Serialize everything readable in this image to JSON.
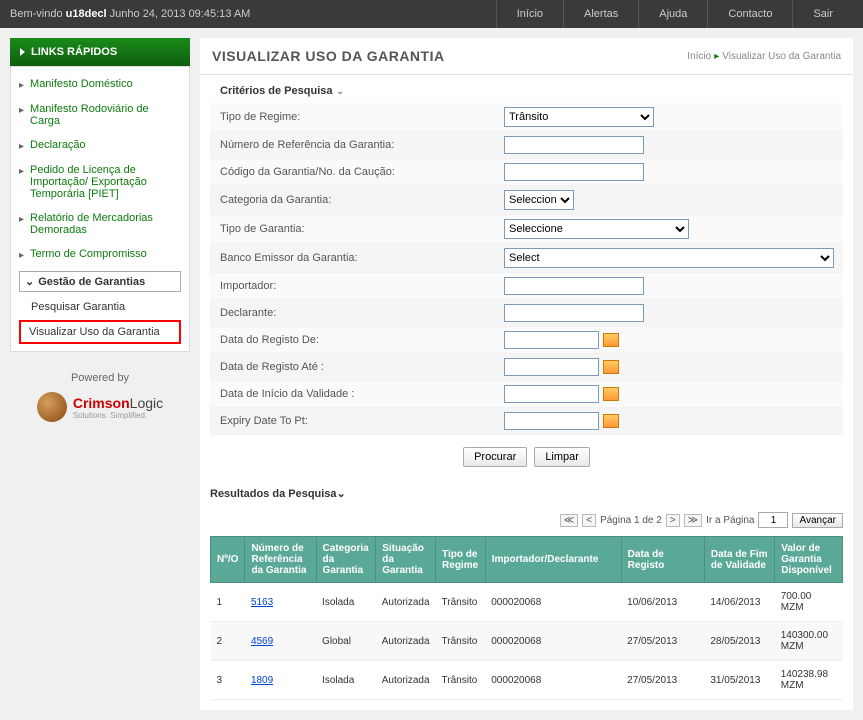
{
  "topbar": {
    "welcome_prefix": "Bem-vindo ",
    "user": "u18decl",
    "datetime": " Junho 24, 2013 09:45:13 AM",
    "nav": [
      "Início",
      "Alertas",
      "Ajuda",
      "Contacto",
      "Sair"
    ]
  },
  "sidebar": {
    "header": "LINKS RÁPIDOS",
    "items": [
      "Manifesto Doméstico",
      "Manifesto Rodoviário de Carga",
      "Declaração",
      "Pedido de Licença de Importação/ Exportação Temporária [PIET]",
      "Relatório de Mercadorias Demoradas",
      "Termo de Compromisso"
    ],
    "sub_header": "Gestão de Garantias",
    "sub_items": [
      "Pesquisar Garantia",
      "Visualizar Uso da Garantia"
    ]
  },
  "powered": {
    "label": "Powered by",
    "brand_a": "Crimson",
    "brand_b": "Logic",
    "tag": "Solutions. Simplified."
  },
  "page": {
    "title": "VISUALIZAR USO DA GARANTIA",
    "bc_home": "Início",
    "bc_current": "Visualizar Uso da Garantia"
  },
  "criteria": {
    "title": "Critérios de Pesquisa",
    "labels": {
      "tipo_regime": "Tipo de Regime:",
      "num_ref": "Número de Referência da Garantia:",
      "codigo": "Código da Garantia/No. da Caução:",
      "categoria": "Categoria da Garantia:",
      "tipo_garantia": "Tipo de Garantia:",
      "banco": "Banco Emissor da Garantia:",
      "importador": "Importador:",
      "declarante": "Declarante:",
      "data_de": "Data do Registo De:",
      "data_ate": "Data de Registo Até :",
      "data_inicio": "Data de Início da Validade :",
      "expiry": "Expiry Date To Pt:"
    },
    "values": {
      "tipo_regime": "Trânsito",
      "categoria": "Seleccione",
      "tipo_garantia": "Seleccione",
      "banco": "Select"
    },
    "buttons": {
      "search": "Procurar",
      "clear": "Limpar"
    }
  },
  "results": {
    "title": "Resultados da Pesquisa",
    "pager": {
      "page_text": "Página 1 de 2",
      "goto_label": "Ir a Página",
      "goto_value": "1",
      "go_btn": "Avançar"
    },
    "headers": {
      "no": "Nº/O",
      "ref": "Número de Referência da Garantia",
      "cat": "Categoria da Garantia",
      "sit": "Situação da Garantia",
      "tipo": "Tipo de Regime",
      "imp": "Importador/Declarante",
      "data": "Data de Registo",
      "fim": "Data de Fim de Validade",
      "val": "Valor de Garantia Disponível"
    },
    "rows": [
      {
        "no": "1",
        "ref": "5163",
        "cat": "Isolada",
        "sit": "Autorizada",
        "tipo": "Trânsito",
        "imp": "000020068",
        "data": "10/06/2013",
        "fim": "14/06/2013",
        "val": "700.00 MZM"
      },
      {
        "no": "2",
        "ref": "4569",
        "cat": "Global",
        "sit": "Autorizada",
        "tipo": "Trânsito",
        "imp": "000020068",
        "data": "27/05/2013",
        "fim": "28/05/2013",
        "val": "140300.00 MZM"
      },
      {
        "no": "3",
        "ref": "1809",
        "cat": "Isolada",
        "sit": "Autorizada",
        "tipo": "Trânsito",
        "imp": "000020068",
        "data": "27/05/2013",
        "fim": "31/05/2013",
        "val": "140238.98 MZM"
      }
    ]
  }
}
